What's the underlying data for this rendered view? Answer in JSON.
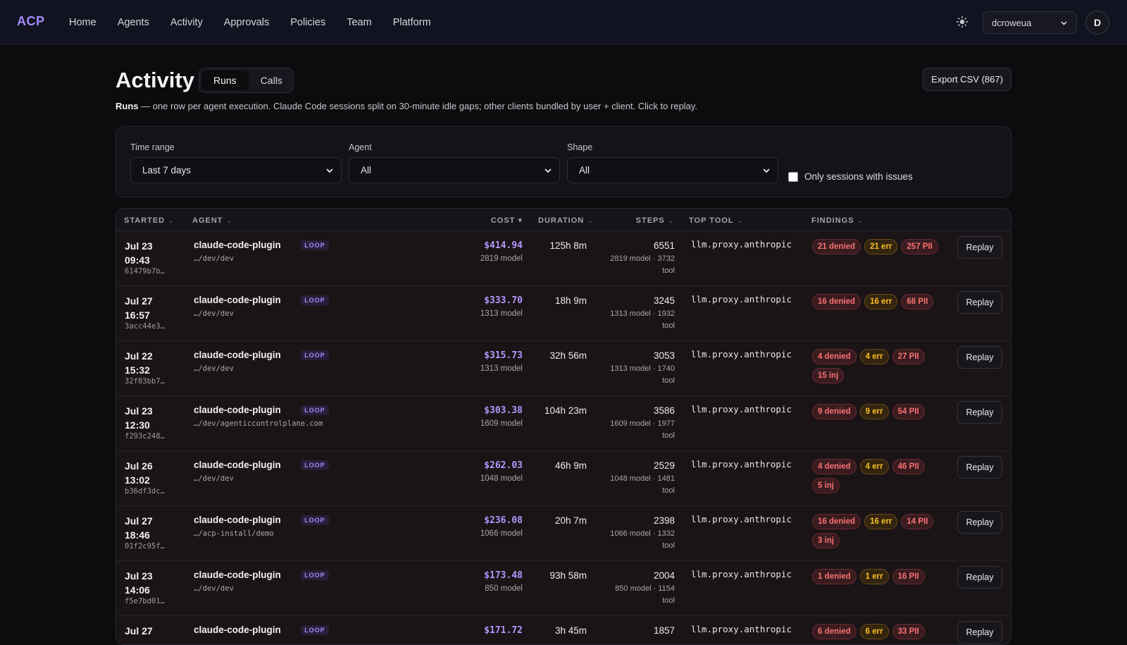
{
  "nav": {
    "brand": "ACP",
    "items": [
      "Home",
      "Agents",
      "Activity",
      "Approvals",
      "Policies",
      "Team",
      "Platform"
    ],
    "org": "dcroweua",
    "avatar_initial": "D",
    "theme_icon": "sun-icon"
  },
  "header": {
    "title": "Activity",
    "tabs": [
      "Runs",
      "Calls"
    ],
    "active_tab": "Runs",
    "export_label": "Export CSV (867)",
    "subtitle_bold": "Runs",
    "subtitle_rest": " — one row per agent execution. Claude Code sessions split on 30-minute idle gaps; other clients bundled by user + client. Click to replay."
  },
  "filters": {
    "time_range": {
      "label": "Time range",
      "value": "Last 7 days"
    },
    "agent": {
      "label": "Agent",
      "value": "All"
    },
    "shape": {
      "label": "Shape",
      "value": "All"
    },
    "issues_label": "Only sessions with issues",
    "issues_checked": false
  },
  "table": {
    "columns": {
      "started": "STARTED",
      "agent": "AGENT",
      "cost": "COST",
      "duration": "DURATION",
      "steps": "STEPS",
      "top_tool": "TOP TOOL",
      "findings": "FINDINGS"
    },
    "sort_desc_glyph": "▾",
    "sort_glyph": "⌄",
    "replay_label": "Replay",
    "rows": [
      {
        "date": "Jul 23",
        "time": "09:43",
        "id": "61479b7b…",
        "agent": "claude-code-plugin",
        "tag": "LOOP",
        "path": "…/dev/dev",
        "cost": "$414.94",
        "cost_model": "2819 model",
        "duration": "125h 8m",
        "steps": "6551",
        "steps_line1": "2819 model · 3732",
        "steps_line2": "tool",
        "tool": "llm.proxy.anthropic",
        "findings": [
          {
            "t": "21 denied",
            "c": "red"
          },
          {
            "t": "21 err",
            "c": "amber"
          },
          {
            "t": "257 PII",
            "c": "red"
          }
        ]
      },
      {
        "date": "Jul 27",
        "time": "16:57",
        "id": "3acc44e3…",
        "agent": "claude-code-plugin",
        "tag": "LOOP",
        "path": "…/dev/dev",
        "cost": "$333.70",
        "cost_model": "1313 model",
        "duration": "18h 9m",
        "steps": "3245",
        "steps_line1": "1313 model · 1932",
        "steps_line2": "tool",
        "tool": "llm.proxy.anthropic",
        "findings": [
          {
            "t": "16 denied",
            "c": "red"
          },
          {
            "t": "16 err",
            "c": "amber"
          },
          {
            "t": "68 PII",
            "c": "red"
          }
        ]
      },
      {
        "date": "Jul 22",
        "time": "15:32",
        "id": "32f03bb7…",
        "agent": "claude-code-plugin",
        "tag": "LOOP",
        "path": "…/dev/dev",
        "cost": "$315.73",
        "cost_model": "1313 model",
        "duration": "32h 56m",
        "steps": "3053",
        "steps_line1": "1313 model · 1740",
        "steps_line2": "tool",
        "tool": "llm.proxy.anthropic",
        "findings": [
          {
            "t": "4 denied",
            "c": "red"
          },
          {
            "t": "4 err",
            "c": "amber"
          },
          {
            "t": "27 PII",
            "c": "red"
          },
          {
            "t": "15 inj",
            "c": "red"
          }
        ]
      },
      {
        "date": "Jul 23",
        "time": "12:30",
        "id": "f293c248…",
        "agent": "claude-code-plugin",
        "tag": "LOOP",
        "path": "…/dev/agenticcontrolplane.com",
        "cost": "$303.38",
        "cost_model": "1609 model",
        "duration": "104h 23m",
        "steps": "3586",
        "steps_line1": "1609 model · 1977",
        "steps_line2": "tool",
        "tool": "llm.proxy.anthropic",
        "findings": [
          {
            "t": "9 denied",
            "c": "red"
          },
          {
            "t": "9 err",
            "c": "amber"
          },
          {
            "t": "54 PII",
            "c": "red"
          }
        ]
      },
      {
        "date": "Jul 26",
        "time": "13:02",
        "id": "b36df3dc…",
        "agent": "claude-code-plugin",
        "tag": "LOOP",
        "path": "…/dev/dev",
        "cost": "$262.03",
        "cost_model": "1048 model",
        "duration": "46h 9m",
        "steps": "2529",
        "steps_line1": "1048 model · 1481",
        "steps_line2": "tool",
        "tool": "llm.proxy.anthropic",
        "findings": [
          {
            "t": "4 denied",
            "c": "red"
          },
          {
            "t": "4 err",
            "c": "amber"
          },
          {
            "t": "46 PII",
            "c": "red"
          },
          {
            "t": "5 inj",
            "c": "red"
          }
        ]
      },
      {
        "date": "Jul 27",
        "time": "18:46",
        "id": "01f2c95f…",
        "agent": "claude-code-plugin",
        "tag": "LOOP",
        "path": "…/acp-install/demo",
        "cost": "$236.08",
        "cost_model": "1066 model",
        "duration": "20h 7m",
        "steps": "2398",
        "steps_line1": "1066 model · 1332",
        "steps_line2": "tool",
        "tool": "llm.proxy.anthropic",
        "findings": [
          {
            "t": "16 denied",
            "c": "red"
          },
          {
            "t": "16 err",
            "c": "amber"
          },
          {
            "t": "14 PII",
            "c": "red"
          },
          {
            "t": "3 inj",
            "c": "red"
          }
        ]
      },
      {
        "date": "Jul 23",
        "time": "14:06",
        "id": "f5e7bd01…",
        "agent": "claude-code-plugin",
        "tag": "LOOP",
        "path": "…/dev/dev",
        "cost": "$173.48",
        "cost_model": "850 model",
        "duration": "93h 58m",
        "steps": "2004",
        "steps_line1": "850 model · 1154",
        "steps_line2": "tool",
        "tool": "llm.proxy.anthropic",
        "findings": [
          {
            "t": "1 denied",
            "c": "red"
          },
          {
            "t": "1 err",
            "c": "amber"
          },
          {
            "t": "16 PII",
            "c": "red"
          }
        ]
      },
      {
        "date": "Jul 27",
        "time": "",
        "id": "",
        "agent": "claude-code-plugin",
        "tag": "LOOP",
        "path": "",
        "cost": "$171.72",
        "cost_model": "",
        "duration": "3h 45m",
        "steps": "1857",
        "steps_line1": "",
        "steps_line2": "",
        "tool": "llm.proxy.anthropic",
        "findings": [
          {
            "t": "6 denied",
            "c": "red"
          },
          {
            "t": "6 err",
            "c": "amber"
          },
          {
            "t": "33 PII",
            "c": "red"
          }
        ]
      }
    ]
  },
  "colors": {
    "accent": "#a78bfa",
    "cost": "#b497ff",
    "danger": "#f87171",
    "warn": "#fbbf24",
    "bg": "#0c0c0e"
  }
}
